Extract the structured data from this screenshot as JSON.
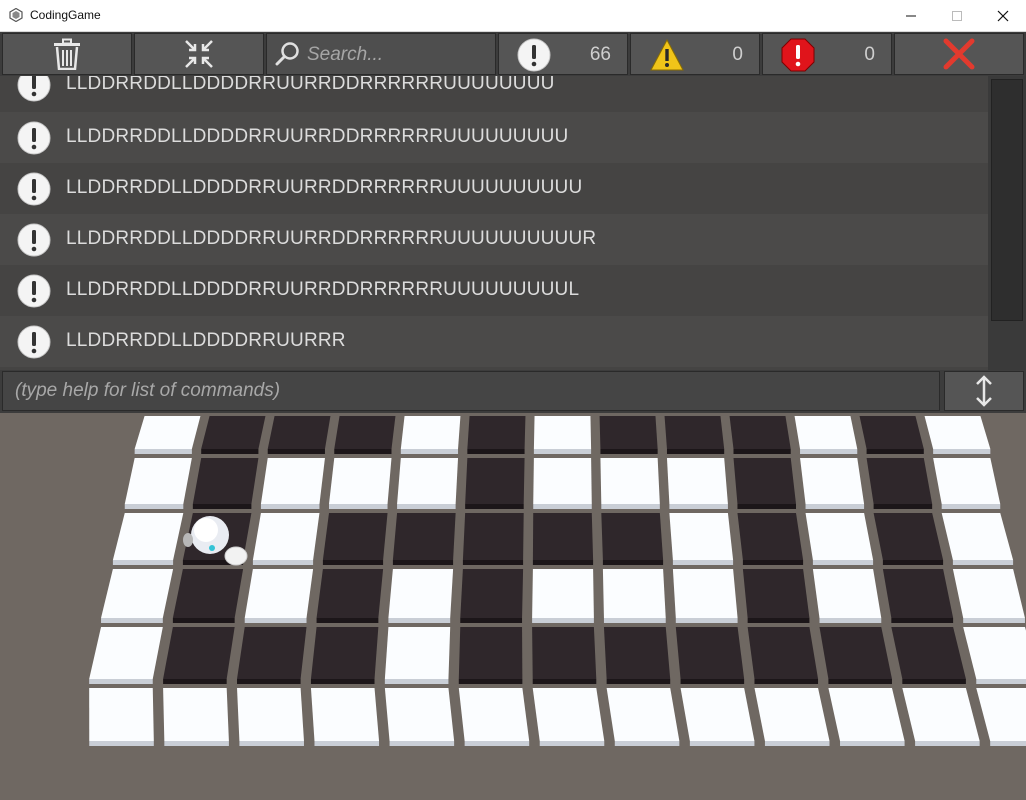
{
  "window": {
    "title": "CodingGame"
  },
  "toolbar": {
    "search_placeholder": "Search...",
    "info_count": "66",
    "warning_count": "0",
    "error_count": "0"
  },
  "log": [
    "LLDDRRDDLLDDDDRRUURRDDRRRRRRUUUUUUUU",
    "LLDDRRDDLLDDDDRRUURRDDRRRRRRUUUUUUUUU",
    "LLDDRRDDLLDDDDRRUURRDDRRRRRRUUUUUUUUUU",
    "LLDDRRDDLLDDDDRRUURRDDRRRRRRUUUUUUUUUUR",
    "LLDDRRDDLLDDDDRRUURRDDRRRRRRUUUUUUUUUL",
    "LLDDRRDDLLDDDDRRUURRR"
  ],
  "command": {
    "placeholder": "(type help for list of commands)"
  },
  "board": {
    "grid": [
      "WBBBWBWBBBWBW",
      "WBWWWBWWWBWBW",
      "WBWBBBBBWBWBW",
      "WBWBWBWWWBWBW",
      "WBBBWBBBBBBBW",
      "WWWWWWWWWWWWW"
    ],
    "robot": {
      "row": 2,
      "col": 1
    },
    "colors": {
      "white": "#fbfdff",
      "black": "#2f272b",
      "floor": "#6f6862"
    }
  }
}
